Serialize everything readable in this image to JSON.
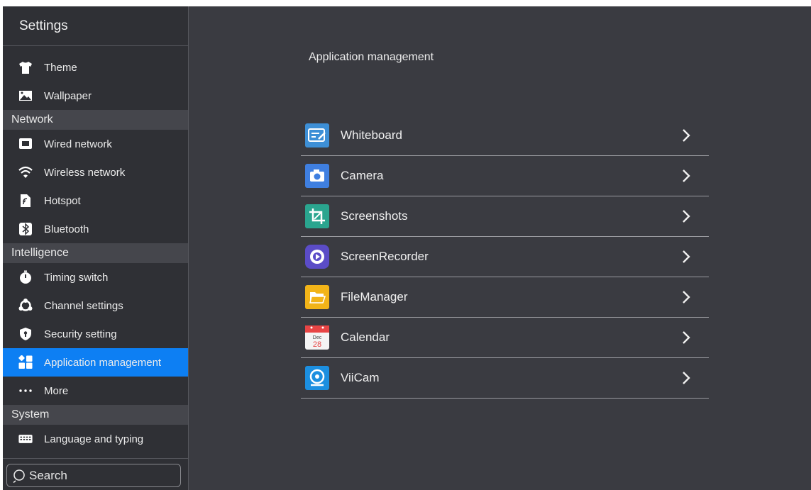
{
  "sidebar": {
    "title": "Settings",
    "items": [
      {
        "type": "item",
        "label": "Theme",
        "icon": "shirt-icon"
      },
      {
        "type": "item",
        "label": "Wallpaper",
        "icon": "image-icon"
      },
      {
        "type": "section",
        "label": "Network"
      },
      {
        "type": "item",
        "label": "Wired network",
        "icon": "monitor-icon"
      },
      {
        "type": "item",
        "label": "Wireless network",
        "icon": "wifi-icon"
      },
      {
        "type": "item",
        "label": "Hotspot",
        "icon": "hotspot-icon"
      },
      {
        "type": "item",
        "label": "Bluetooth",
        "icon": "bluetooth-icon"
      },
      {
        "type": "section",
        "label": "Intelligence"
      },
      {
        "type": "item",
        "label": "Timing switch",
        "icon": "timer-icon"
      },
      {
        "type": "item",
        "label": "Channel settings",
        "icon": "channel-icon"
      },
      {
        "type": "item",
        "label": "Security setting",
        "icon": "shield-icon"
      },
      {
        "type": "item",
        "label": "Application management",
        "icon": "apps-icon",
        "active": true
      },
      {
        "type": "item",
        "label": "More",
        "icon": "more-icon"
      },
      {
        "type": "section",
        "label": "System"
      },
      {
        "type": "item",
        "label": "Language and typing",
        "icon": "keyboard-icon"
      }
    ],
    "search_label": "Search"
  },
  "main": {
    "title": "Application management",
    "apps": [
      {
        "label": "Whiteboard",
        "icon": "whiteboard-icon",
        "color": "#3d8fd6"
      },
      {
        "label": "Camera",
        "icon": "camera-icon",
        "color": "#3f7fe0"
      },
      {
        "label": "Screenshots",
        "icon": "crop-icon",
        "color": "#2aa58f"
      },
      {
        "label": "ScreenRecorder",
        "icon": "recorder-icon",
        "color": "#5b4cc7"
      },
      {
        "label": "FileManager",
        "icon": "folder-icon",
        "color": "#f2b418"
      },
      {
        "label": "Calendar",
        "icon": "calendar-icon",
        "color": "#e84545",
        "month": "Dec",
        "day": "28"
      },
      {
        "label": "ViiCam",
        "icon": "viicam-icon",
        "color": "#1c8fe0"
      }
    ]
  },
  "colors": {
    "accent": "#0d7ff3",
    "background": "#3a3b41",
    "sidebar": "#2f3035"
  }
}
